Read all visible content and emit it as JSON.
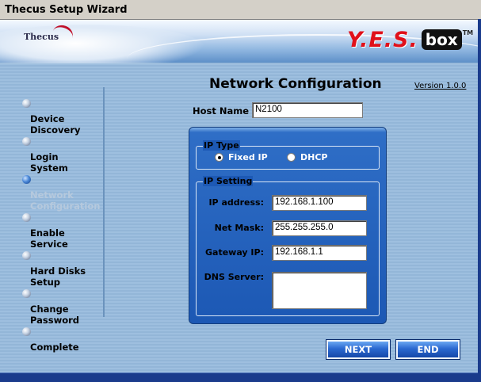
{
  "window": {
    "title": "Thecus Setup Wizard"
  },
  "banner": {
    "brand_left": "Thecus",
    "brand_right_main": "Y.E.S.",
    "brand_right_box": "box",
    "brand_right_tm": "TM"
  },
  "steps": [
    {
      "label": "Device\nDiscovery",
      "state": "done"
    },
    {
      "label": "Login\nSystem",
      "state": "done"
    },
    {
      "label": "Network\nConfiguration",
      "state": "current"
    },
    {
      "label": "Enable\nService",
      "state": "pending"
    },
    {
      "label": "Hard Disks\nSetup",
      "state": "pending"
    },
    {
      "label": "Change\nPassword",
      "state": "pending"
    },
    {
      "label": "Complete",
      "state": "pending"
    }
  ],
  "page": {
    "title": "Network Configuration",
    "version": "Version 1.0.0"
  },
  "hostname": {
    "label": "Host Name",
    "value": "N2100"
  },
  "ip_type": {
    "title": "IP Type",
    "options": [
      "Fixed IP",
      "DHCP"
    ],
    "selected": "Fixed IP"
  },
  "ip_setting": {
    "title": "IP Setting",
    "ip_address": {
      "label": "IP address:",
      "value": "192.168.1.100"
    },
    "net_mask": {
      "label": "Net Mask:",
      "value": "255.255.255.0"
    },
    "gateway": {
      "label": "Gateway IP:",
      "value": "192.168.1.1"
    },
    "dns": {
      "label": "DNS Server:",
      "value": ""
    }
  },
  "buttons": {
    "next": "NEXT",
    "end": "END"
  },
  "colors": {
    "panel_blue": "#1c58b4",
    "banner_red": "#e0101a",
    "background": "#9ebfdf"
  }
}
